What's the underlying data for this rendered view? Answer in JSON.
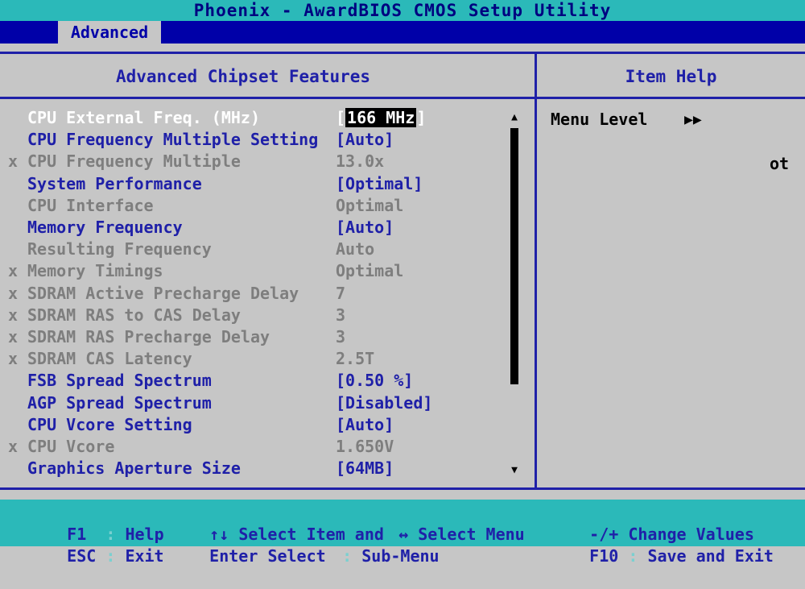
{
  "title": "Phoenix - AwardBIOS CMOS Setup Utility",
  "menu": {
    "active_tab": "Advanced"
  },
  "left_panel": {
    "title": "Advanced Chipset Features"
  },
  "right_panel": {
    "title": "Item Help",
    "menu_level_label": "Menu Level",
    "menu_level_arrows": "▶▶",
    "fragment": "ot"
  },
  "settings": [
    {
      "mark": "",
      "label": "CPU External Freq. (MHz)",
      "value": "166 MHz",
      "state": "active"
    },
    {
      "mark": "",
      "label": "CPU Frequency Multiple Setting",
      "value": "[Auto]",
      "state": "normal"
    },
    {
      "mark": "x",
      "label": "CPU Frequency Multiple",
      "value": "13.0x",
      "state": "dim"
    },
    {
      "mark": "",
      "label": "System Performance",
      "value": "[Optimal]",
      "state": "normal"
    },
    {
      "mark": "",
      "label": "CPU Interface",
      "value": "Optimal",
      "state": "dim"
    },
    {
      "mark": "",
      "label": "Memory Frequency",
      "value": "[Auto]",
      "state": "normal"
    },
    {
      "mark": "",
      "label": "Resulting Frequency",
      "value": "Auto",
      "state": "dim"
    },
    {
      "mark": "x",
      "label": "Memory Timings",
      "value": "Optimal",
      "state": "dim"
    },
    {
      "mark": "x",
      "label": "SDRAM Active Precharge Delay",
      "value": "7",
      "state": "dim"
    },
    {
      "mark": "x",
      "label": "SDRAM RAS to CAS Delay",
      "value": "3",
      "state": "dim"
    },
    {
      "mark": "x",
      "label": "SDRAM RAS Precharge Delay",
      "value": "3",
      "state": "dim"
    },
    {
      "mark": "x",
      "label": "SDRAM CAS Latency",
      "value": "2.5T",
      "state": "dim"
    },
    {
      "mark": "",
      "label": "FSB Spread Spectrum",
      "value": "[0.50 %]",
      "state": "normal"
    },
    {
      "mark": "",
      "label": "AGP Spread Spectrum",
      "value": "[Disabled]",
      "state": "normal"
    },
    {
      "mark": "",
      "label": "CPU Vcore Setting",
      "value": "[Auto]",
      "state": "normal"
    },
    {
      "mark": "x",
      "label": "CPU Vcore",
      "value": "1.650V",
      "state": "dim"
    },
    {
      "mark": "",
      "label": "Graphics Aperture Size",
      "value": "[64MB]",
      "state": "normal"
    }
  ],
  "scrollbar": {
    "up": "▲",
    "down": "▼"
  },
  "footer": [
    {
      "key": "F1",
      "sep": ":",
      "desc": "Help"
    },
    {
      "key": "↑↓",
      "sep": "",
      "desc": "Select Item and"
    },
    {
      "key": "↔",
      "sep": "",
      "desc": "Select Menu"
    },
    {
      "key": "-/+",
      "sep": "",
      "desc": "Change Values"
    },
    {
      "key": "ESC",
      "sep": ":",
      "desc": "Exit"
    },
    {
      "key": "Enter",
      "sep": "",
      "desc": "Select"
    },
    {
      "key": ":",
      "sep": "",
      "desc": "Sub-Menu"
    },
    {
      "key": "F10",
      "sep": ":",
      "desc": "Save and Exit"
    }
  ]
}
